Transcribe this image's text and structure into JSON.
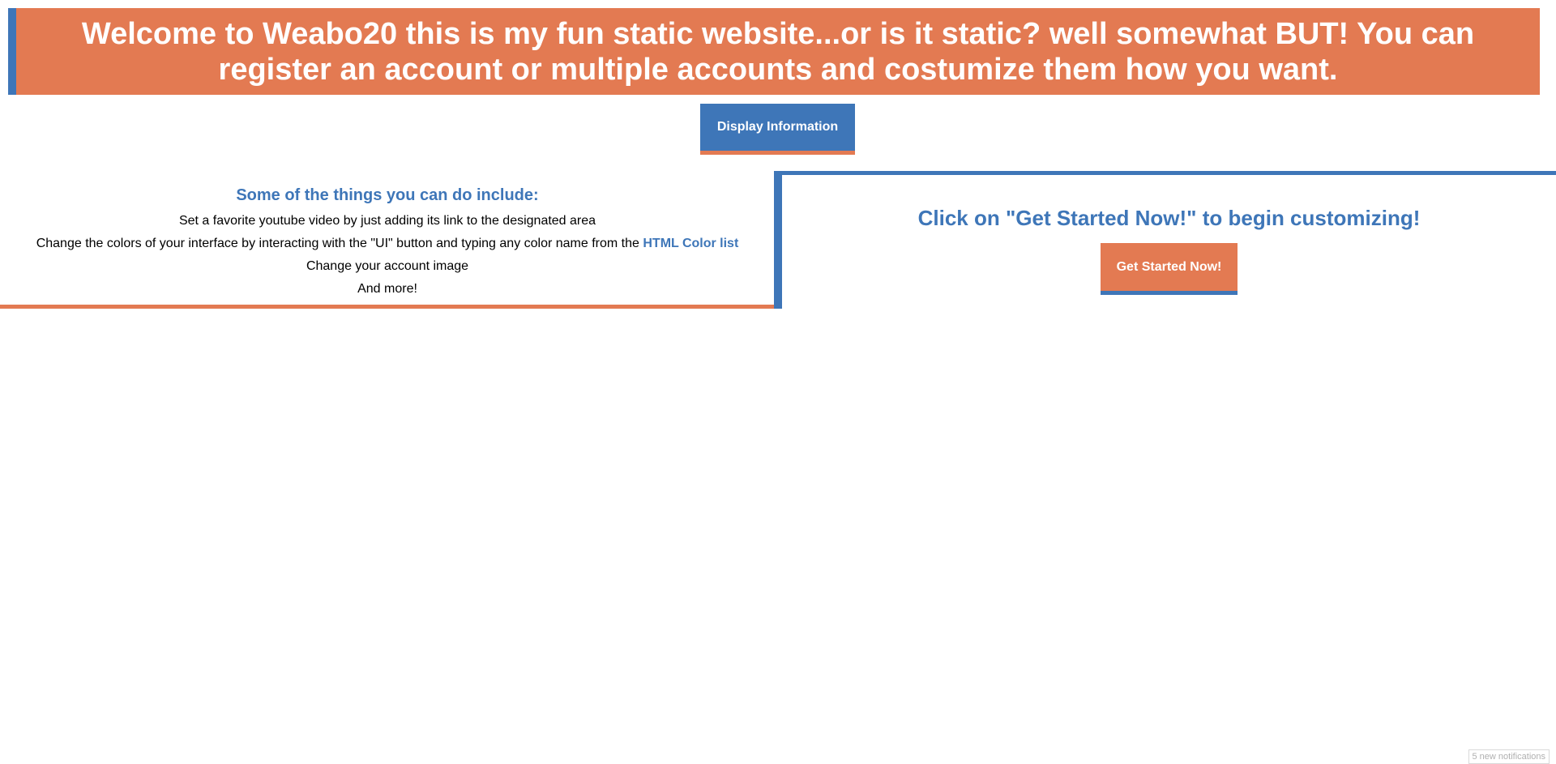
{
  "colors": {
    "accent_orange": "#e37a52",
    "accent_blue": "#3e76b8"
  },
  "banner": {
    "text": "Welcome to Weabo20 this is my fun static website...or is it static? well somewhat BUT! You can register an account or multiple accounts and costumize them how you want."
  },
  "display_button": {
    "label": "Display Information"
  },
  "features": {
    "heading": "Some of the things you can do include:",
    "item1": "Set a favorite youtube video by just adding its link to the designated area",
    "item2_prefix": "Change the colors of your interface by interacting with the \"UI\" button and typing any color name from the ",
    "item2_link": "HTML Color list",
    "item3": "Change your account image",
    "item4": "And more!"
  },
  "get_started": {
    "heading": "Click on \"Get Started Now!\" to begin customizing!",
    "button_label": "Get Started Now!"
  },
  "notifications": {
    "text": "5 new notifications"
  }
}
